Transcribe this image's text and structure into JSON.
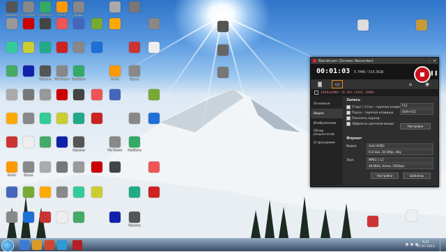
{
  "desktop": {
    "icons": [
      {
        "label": "Корзина",
        "color": "#555"
      },
      {
        "label": "File Viewer",
        "color": "#888"
      },
      {
        "label": "FastStone",
        "color": "#3a6"
      },
      {
        "label": "Агент",
        "color": "#f90"
      },
      {
        "label": "Ярлык",
        "color": "#888"
      },
      {
        "label": "",
        "color": "#aaa"
      },
      {
        "label": "",
        "color": "#777"
      },
      {
        "label": "",
        "color": "#999"
      },
      {
        "label": "",
        "color": "#c00"
      },
      {
        "label": "",
        "color": "#444"
      },
      {
        "label": "",
        "color": "#e55"
      },
      {
        "label": "",
        "color": "#46b"
      },
      {
        "label": "",
        "color": "#7a3"
      },
      {
        "label": "",
        "color": "#fa0"
      },
      {
        "label": "",
        "color": "#888"
      },
      {
        "label": "",
        "color": "#3c9"
      },
      {
        "label": "",
        "color": "#cc3"
      },
      {
        "label": "",
        "color": "#2a8"
      },
      {
        "label": "",
        "color": "#c22"
      },
      {
        "label": "",
        "color": "#888"
      },
      {
        "label": "",
        "color": "#1e6fd6"
      },
      {
        "label": "",
        "color": "#c33"
      },
      {
        "label": "",
        "color": "#eee"
      },
      {
        "label": "",
        "color": "#4a6"
      },
      {
        "label": "",
        "color": "#12a"
      }
    ]
  },
  "bandicam": {
    "title": "Bandicam (Screen Recorder)",
    "time": "00:01:03",
    "size": "5.7MB / 315.9GB",
    "target": "1920x1080 - (0, 26), (1921, 1086)",
    "nav": [
      "Основные",
      "Видео",
      "Изображение",
      "Обзор результатов",
      "О программе"
    ],
    "selected_nav": "Видео",
    "record_section": "Запись",
    "options": [
      {
        "label": "Старт / Стоп - горячая клавиша",
        "value": "F12"
      },
      {
        "label": "Пауза - горячая клавиша",
        "value": "Shift+F12"
      },
      {
        "label": "Показать курсор",
        "value": ""
      },
      {
        "label": "Эффекты щелчков мыши",
        "value": ""
      }
    ],
    "settings_btn": "Настройки",
    "format_section": "Формат",
    "video_label": "Видео",
    "video_fmt": "Avid (XVID)",
    "video_detail": "Full Size, 30.00fps, 80q",
    "audio_label": "Звук",
    "audio_fmt": "MPEG-1 L2",
    "audio_detail": "48.0KHz, stereo, 192kbps",
    "format_settings_btn": "Настройки",
    "templates_btn": "Шаблоны"
  },
  "taskbar": {
    "time": "9:21",
    "date": "07.07.2013"
  }
}
